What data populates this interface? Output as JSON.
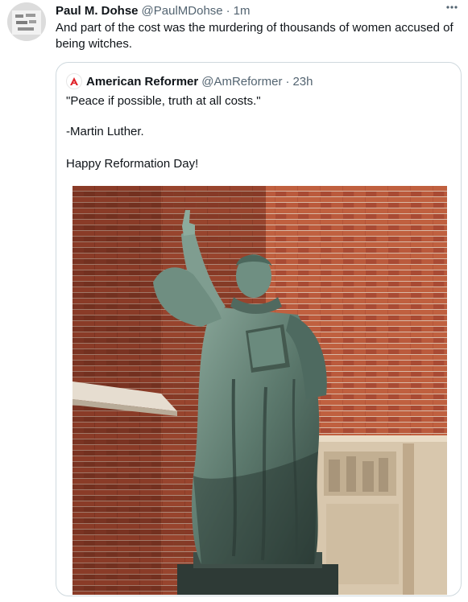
{
  "tweet": {
    "author_name": "Paul M. Dohse",
    "author_handle": "@PaulMDohse",
    "separator": "·",
    "time": "1m",
    "more_icon": "more-horizontal-icon",
    "text": "And part of the cost was the murdering of thousands of women accused of being witches."
  },
  "quote": {
    "author_name": "American Reformer",
    "author_handle": "@AmReformer",
    "separator": "·",
    "time": "23h",
    "lines": [
      "\"Peace if possible, truth at all costs.\"",
      "-Martin Luther.",
      "Happy Reformation Day!"
    ]
  },
  "colors": {
    "brick": "#b5553a",
    "brick_dark": "#8e3c28",
    "statue": "#5d7b70",
    "logo_red": "#e0242b"
  }
}
